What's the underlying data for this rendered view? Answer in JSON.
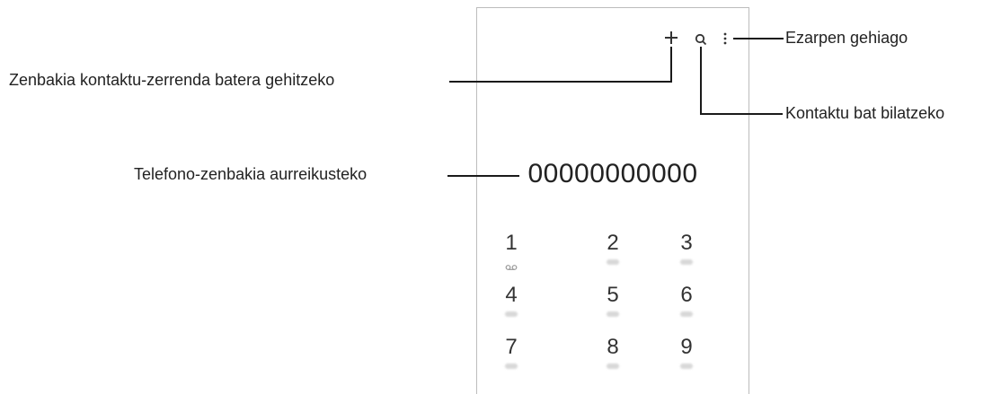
{
  "callouts": {
    "more_options": "Ezarpen gehiago",
    "add_contact": "Zenbakia kontaktu-zerrenda batera gehitzeko",
    "search_contact": "Kontaktu bat bilatzeko",
    "preview_number": "Telefono-zenbakia aurreikusteko"
  },
  "dialer": {
    "number": "00000000000",
    "keys": [
      {
        "digit": "1"
      },
      {
        "digit": "2"
      },
      {
        "digit": "3"
      },
      {
        "digit": "4"
      },
      {
        "digit": "5"
      },
      {
        "digit": "6"
      },
      {
        "digit": "7"
      },
      {
        "digit": "8"
      },
      {
        "digit": "9"
      }
    ]
  },
  "icons": {
    "add": "plus-icon",
    "search": "search-icon",
    "more": "more-vertical-icon",
    "voicemail": "voicemail-icon"
  }
}
